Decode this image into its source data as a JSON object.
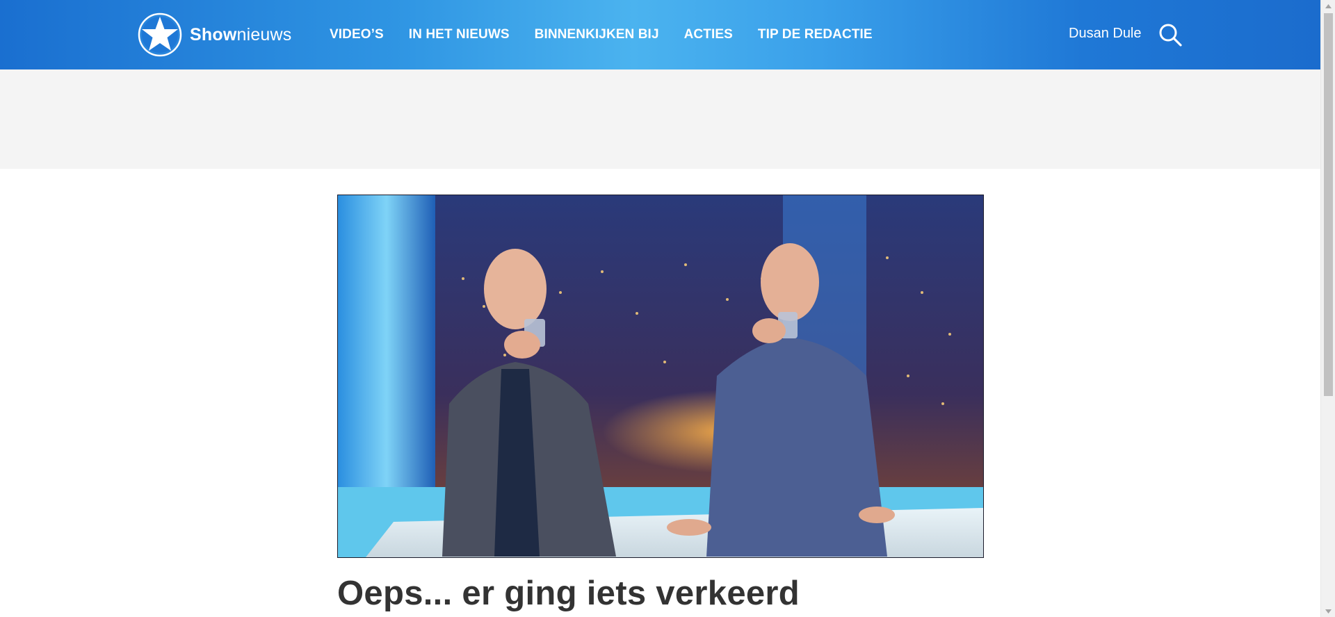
{
  "header": {
    "logo_show": "Show",
    "logo_nieuws": "nieuws",
    "logo_icon": "star-icon",
    "nav": [
      {
        "label": "VIDEO’S"
      },
      {
        "label": "IN HET NIEUWS"
      },
      {
        "label": "BINNENKIJKEN BIJ"
      },
      {
        "label": "ACTIES"
      },
      {
        "label": "TIP DE REDACTIE"
      }
    ],
    "user_name": "Dusan Dule",
    "search_icon": "search-icon"
  },
  "ad_band": {},
  "article": {
    "hero_image": "two-presenters-drinking-water-studio",
    "headline": "Oeps... er ging iets verkeerd"
  },
  "scrollbar": {
    "up_icon": "scroll-up-arrow-icon",
    "down_icon": "scroll-down-arrow-icon"
  },
  "colors": {
    "header_dark": "#1a6fd0",
    "header_light": "#4bb3ef",
    "ad_band": "#f4f4f4",
    "headline": "#333333"
  }
}
